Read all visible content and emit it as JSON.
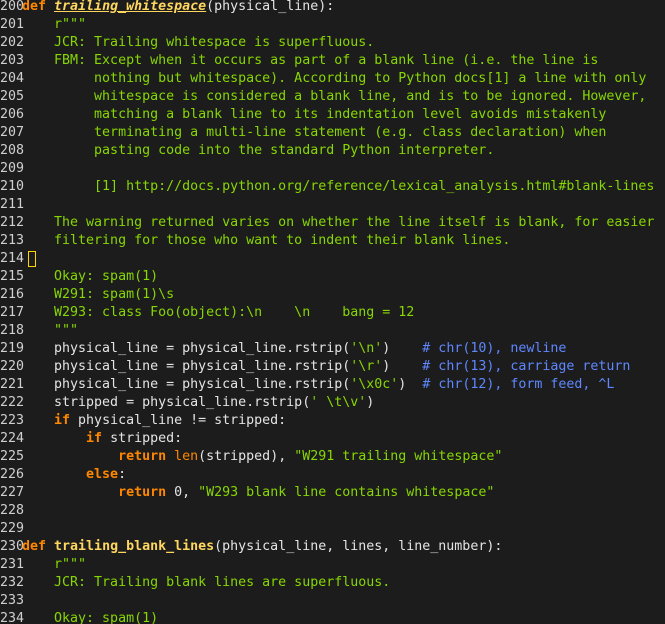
{
  "colors": {
    "background": "#1c1c1c",
    "line_number": "#d0d0d0",
    "keyword": "#ff8700",
    "function_name": "#ffd75f",
    "docstring": "#87d700",
    "string": "#87d700",
    "comment": "#5f87ff",
    "text": "#e4e4e4",
    "cursor": "#ffd700"
  },
  "cursor_line_index": 14,
  "lines": [
    {
      "n": "200",
      "t": [
        {
          "c": "kw",
          "v": "def "
        },
        {
          "c": "fnu",
          "v": "trailing_whitespace"
        },
        {
          "c": "txt",
          "v": "(physical_line):"
        }
      ]
    },
    {
      "n": "201",
      "t": [
        {
          "c": "doc",
          "v": "    r\"\"\""
        }
      ]
    },
    {
      "n": "202",
      "t": [
        {
          "c": "doc",
          "v": "    JCR: Trailing whitespace is superfluous."
        }
      ]
    },
    {
      "n": "203",
      "t": [
        {
          "c": "doc",
          "v": "    FBM: Except when it occurs as part of a blank line (i.e. the line is"
        }
      ]
    },
    {
      "n": "204",
      "t": [
        {
          "c": "doc",
          "v": "         nothing but whitespace). According to Python docs[1] a line with only"
        }
      ]
    },
    {
      "n": "205",
      "t": [
        {
          "c": "doc",
          "v": "         whitespace is considered a blank line, and is to be ignored. However,"
        }
      ]
    },
    {
      "n": "206",
      "t": [
        {
          "c": "doc",
          "v": "         matching a blank line to its indentation level avoids mistakenly"
        }
      ]
    },
    {
      "n": "207",
      "t": [
        {
          "c": "doc",
          "v": "         terminating a multi-line statement (e.g. class declaration) when"
        }
      ]
    },
    {
      "n": "208",
      "t": [
        {
          "c": "doc",
          "v": "         pasting code into the standard Python interpreter."
        }
      ]
    },
    {
      "n": "209",
      "t": []
    },
    {
      "n": "210",
      "t": [
        {
          "c": "doc",
          "v": "         [1] http://docs.python.org/reference/lexical_analysis.html#blank-lines"
        }
      ]
    },
    {
      "n": "211",
      "t": []
    },
    {
      "n": "212",
      "t": [
        {
          "c": "doc",
          "v": "    The warning returned varies on whether the line itself is blank, for easier"
        }
      ]
    },
    {
      "n": "213",
      "t": [
        {
          "c": "doc",
          "v": "    filtering for those who want to indent their blank lines."
        }
      ]
    },
    {
      "n": "214",
      "t": []
    },
    {
      "n": "215",
      "t": [
        {
          "c": "doc",
          "v": "    Okay: spam(1)"
        }
      ]
    },
    {
      "n": "216",
      "t": [
        {
          "c": "doc",
          "v": "    W291: spam(1)\\s"
        }
      ]
    },
    {
      "n": "217",
      "t": [
        {
          "c": "doc",
          "v": "    W293: class Foo(object):\\n    \\n    bang = 12"
        }
      ]
    },
    {
      "n": "218",
      "t": [
        {
          "c": "doc",
          "v": "    \"\"\""
        }
      ]
    },
    {
      "n": "219",
      "t": [
        {
          "c": "txt",
          "v": "    physical_line = physical_line.rstrip("
        },
        {
          "c": "str",
          "v": "'\\n'"
        },
        {
          "c": "txt",
          "v": ")    "
        },
        {
          "c": "cm",
          "v": "# chr(10), newline"
        }
      ]
    },
    {
      "n": "220",
      "t": [
        {
          "c": "txt",
          "v": "    physical_line = physical_line.rstrip("
        },
        {
          "c": "str",
          "v": "'\\r'"
        },
        {
          "c": "txt",
          "v": ")    "
        },
        {
          "c": "cm",
          "v": "# chr(13), carriage return"
        }
      ]
    },
    {
      "n": "221",
      "t": [
        {
          "c": "txt",
          "v": "    physical_line = physical_line.rstrip("
        },
        {
          "c": "str",
          "v": "'\\x0c'"
        },
        {
          "c": "txt",
          "v": ")  "
        },
        {
          "c": "cm",
          "v": "# chr(12), form feed, ^L"
        }
      ]
    },
    {
      "n": "222",
      "t": [
        {
          "c": "txt",
          "v": "    stripped = physical_line.rstrip("
        },
        {
          "c": "str",
          "v": "' \\t\\v'"
        },
        {
          "c": "txt",
          "v": ")"
        }
      ]
    },
    {
      "n": "223",
      "t": [
        {
          "c": "kw",
          "v": "    if "
        },
        {
          "c": "txt",
          "v": "physical_line != stripped:"
        }
      ]
    },
    {
      "n": "224",
      "t": [
        {
          "c": "kw",
          "v": "        if "
        },
        {
          "c": "txt",
          "v": "stripped:"
        }
      ]
    },
    {
      "n": "225",
      "t": [
        {
          "c": "kw",
          "v": "            return "
        },
        {
          "c": "bi",
          "v": "len"
        },
        {
          "c": "txt",
          "v": "(stripped), "
        },
        {
          "c": "str",
          "v": "\"W291 trailing whitespace\""
        }
      ]
    },
    {
      "n": "226",
      "t": [
        {
          "c": "kw",
          "v": "        else"
        },
        {
          "c": "txt",
          "v": ":"
        }
      ]
    },
    {
      "n": "227",
      "t": [
        {
          "c": "kw",
          "v": "            return "
        },
        {
          "c": "txt",
          "v": "0, "
        },
        {
          "c": "str",
          "v": "\"W293 blank line contains whitespace\""
        }
      ]
    },
    {
      "n": "228",
      "t": []
    },
    {
      "n": "229",
      "t": []
    },
    {
      "n": "230",
      "t": [
        {
          "c": "kw",
          "v": "def "
        },
        {
          "c": "fn",
          "v": "trailing_blank_lines"
        },
        {
          "c": "txt",
          "v": "(physical_line, lines, line_number):"
        }
      ]
    },
    {
      "n": "231",
      "t": [
        {
          "c": "doc",
          "v": "    r\"\"\""
        }
      ]
    },
    {
      "n": "232",
      "t": [
        {
          "c": "doc",
          "v": "    JCR: Trailing blank lines are superfluous."
        }
      ]
    },
    {
      "n": "233",
      "t": []
    },
    {
      "n": "234",
      "t": [
        {
          "c": "doc",
          "v": "    Okay: spam(1)"
        }
      ]
    }
  ]
}
